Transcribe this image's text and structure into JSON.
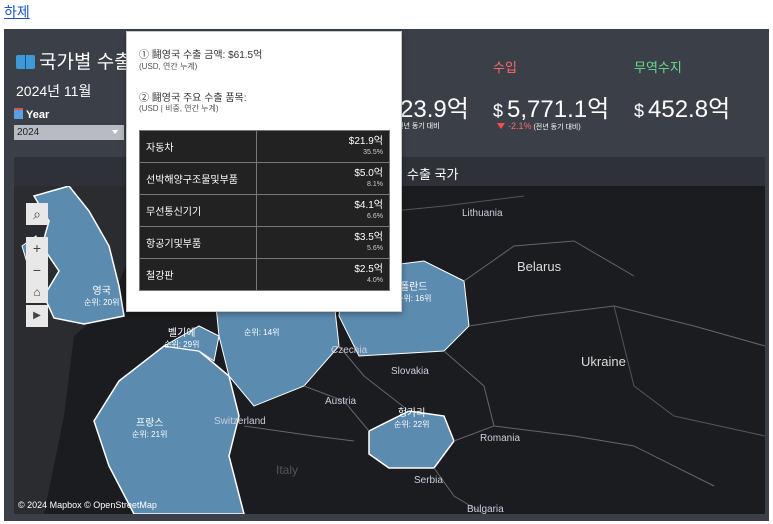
{
  "top_link": "하제",
  "header": {
    "title": "국가별 수출입",
    "date": "2024년 11월",
    "year_label": "Year",
    "year_value": "2024"
  },
  "kpis": {
    "export_value_partial": "23.9억",
    "export_note": "전년 동기 대비",
    "import_title": "수입",
    "import_currency": "$",
    "import_value": "5,771.1억",
    "import_change": "-2.1%",
    "import_note": "(전년 동기 대비)",
    "balance_title": "무역수지",
    "balance_currency": "$",
    "balance_value": "452.8억"
  },
  "colors": {
    "import_title": "#ff6b6b",
    "balance_title": "#6bdc8b",
    "export_country_fill": "#5c8bb0",
    "map_background": "#1b1c1f"
  },
  "map": {
    "header_title": "수출 국가",
    "credit": "© 2024 Mapbox © OpenStreetMap",
    "highlighted_countries": [
      {
        "name": "영국",
        "rank": "순위: 20위"
      },
      {
        "name": "벨기에",
        "rank": "순위: 29위"
      },
      {
        "name": "프랑스",
        "rank": "순위: 21위"
      },
      {
        "name": "폴란드",
        "rank": "순위: 16위"
      },
      {
        "name": "헝가리",
        "rank": "순위: 22위"
      },
      {
        "name": "순위: 14위"
      }
    ],
    "other_countries": [
      "Lithuania",
      "Belarus",
      "Ukraine",
      "Czechia",
      "Slovakia",
      "Austria",
      "Switzerland",
      "Romania",
      "Serbia",
      "Italy",
      "Bulgaria"
    ],
    "tools": [
      "search-icon",
      "zoom-in-icon",
      "zoom-out-icon",
      "home-icon",
      "play-icon"
    ]
  },
  "tooltip": {
    "line1_main": "① 鬪영국 수출 금액: $61.5억",
    "line1_sub": "(USD, 연간 누계)",
    "line2_main": "② 鬪영국 주요 수출 품목:",
    "line2_sub": "(USD | 비중, 연간 누계)",
    "items": [
      {
        "name": "자동차",
        "value": "$21.9억",
        "share": "35.5%"
      },
      {
        "name": "선박해양구조물및부품",
        "value": "$5.0억",
        "share": "8.1%"
      },
      {
        "name": "무선통신기기",
        "value": "$4.1억",
        "share": "6.6%"
      },
      {
        "name": "항공기및부품",
        "value": "$3.5억",
        "share": "5.6%"
      },
      {
        "name": "철강판",
        "value": "$2.5억",
        "share": "4.0%"
      }
    ]
  }
}
